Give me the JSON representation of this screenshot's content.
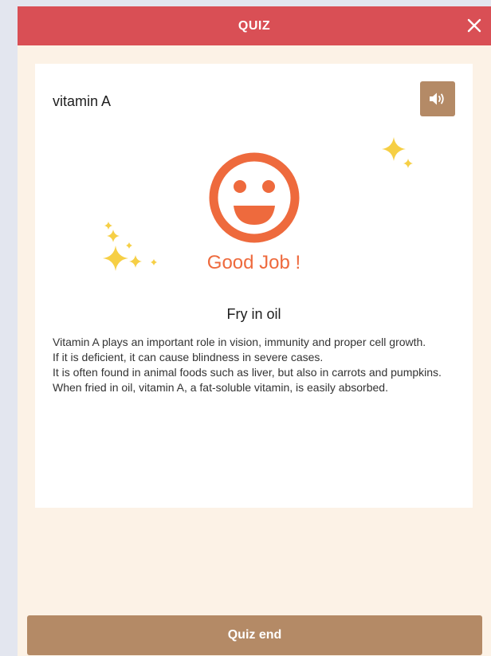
{
  "header": {
    "title": "QUIZ",
    "close_icon": "close-icon"
  },
  "card": {
    "word": "vitamin A",
    "audio_icon": "speaker-icon",
    "result_icon": "smiley-face-icon",
    "result_text": "Good Job !",
    "answer": "Fry in oil",
    "explanation": [
      "Vitamin A plays an important role in vision, immunity and proper cell growth.",
      "If it is deficient, it can cause blindness in severe cases.",
      "It is often found in animal foods such as liver, but also in carrots and pumpkins.",
      "When fried in oil, vitamin A, a fat-soluble vitamin, is easily absorbed."
    ]
  },
  "footer": {
    "end_label": "Quiz end"
  },
  "colors": {
    "header": "#d94f55",
    "panel": "#fcf2e6",
    "accent": "#ee6a3d",
    "button": "#b48a66",
    "sparkle": "#f6cf45"
  }
}
